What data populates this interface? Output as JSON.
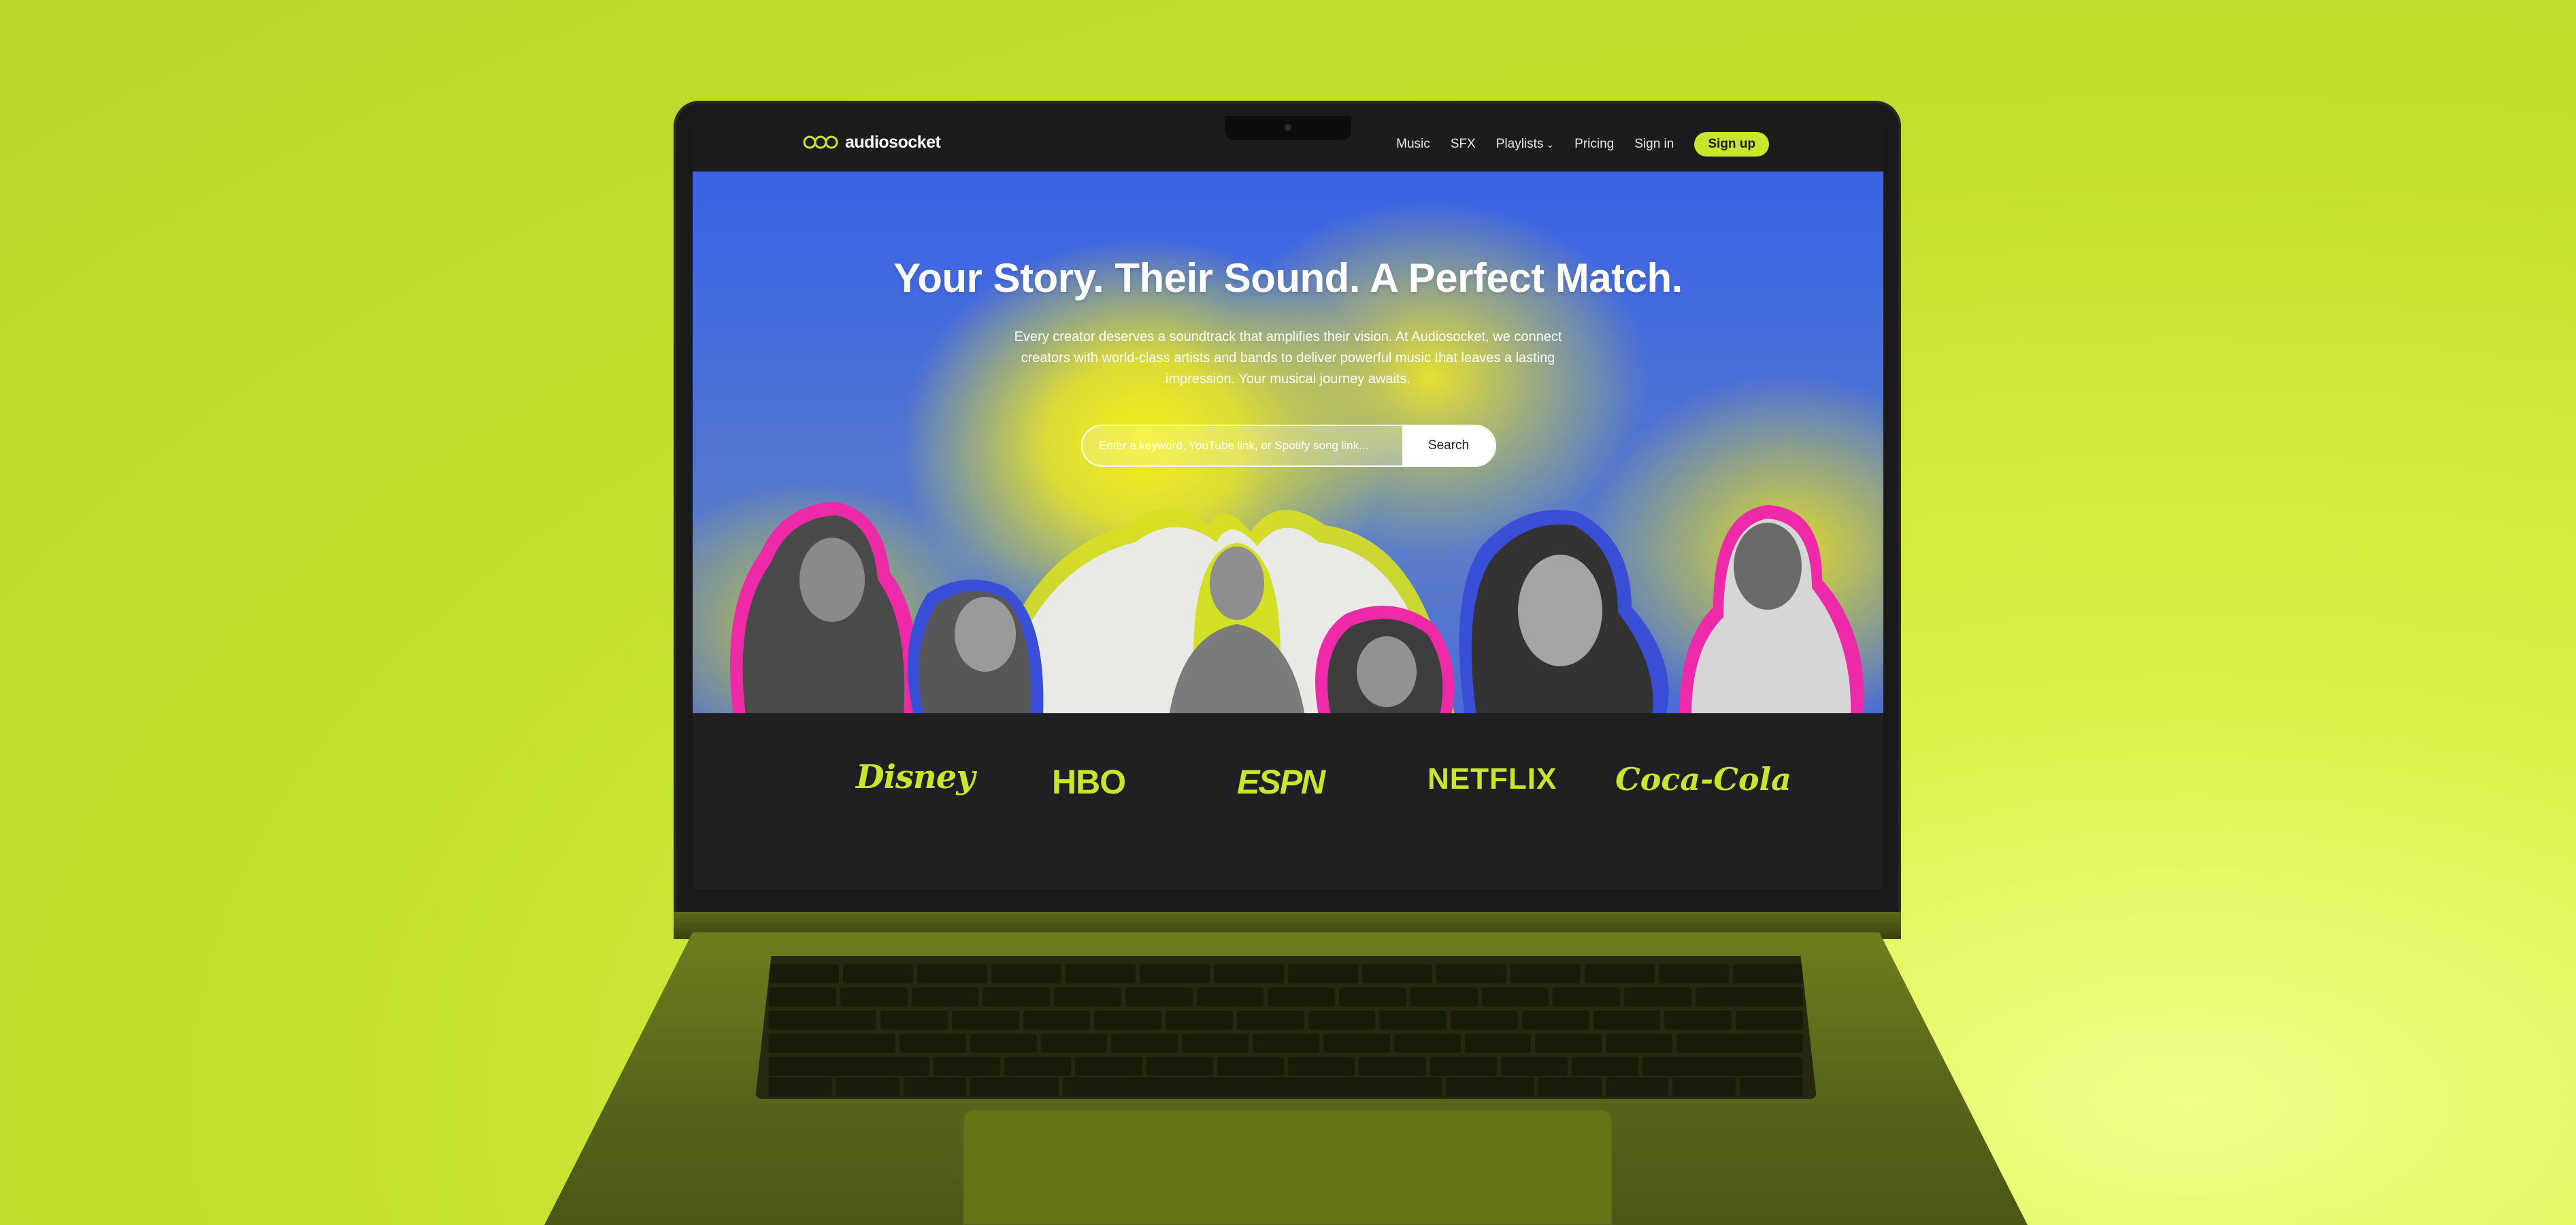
{
  "nav": {
    "logo_text": "audiosocket",
    "links": [
      "Music",
      "SFX",
      "Playlists",
      "Pricing",
      "Sign in"
    ],
    "signup": "Sign up"
  },
  "hero": {
    "title": "Your Story. Their Sound. A Perfect Match.",
    "description": "Every creator deserves a soundtrack that amplifies their vision. At Audiosocket, we connect creators with world-class artists and bands to deliver powerful music that leaves a lasting impression. Your musical journey awaits.",
    "search_placeholder": "Enter a keyword, YouTube link, or Spotify song link...",
    "search_button": "Search"
  },
  "brands": [
    "Disney",
    "HBO",
    "ESPN",
    "NETFLIX",
    "Coca-Cola"
  ],
  "colors": {
    "accent": "#c8e62e",
    "hero_blue": "#3a63e6",
    "hero_yellow": "#f4ee1a",
    "nav_bg": "#1c1c1e",
    "background": "#c6e02e"
  }
}
